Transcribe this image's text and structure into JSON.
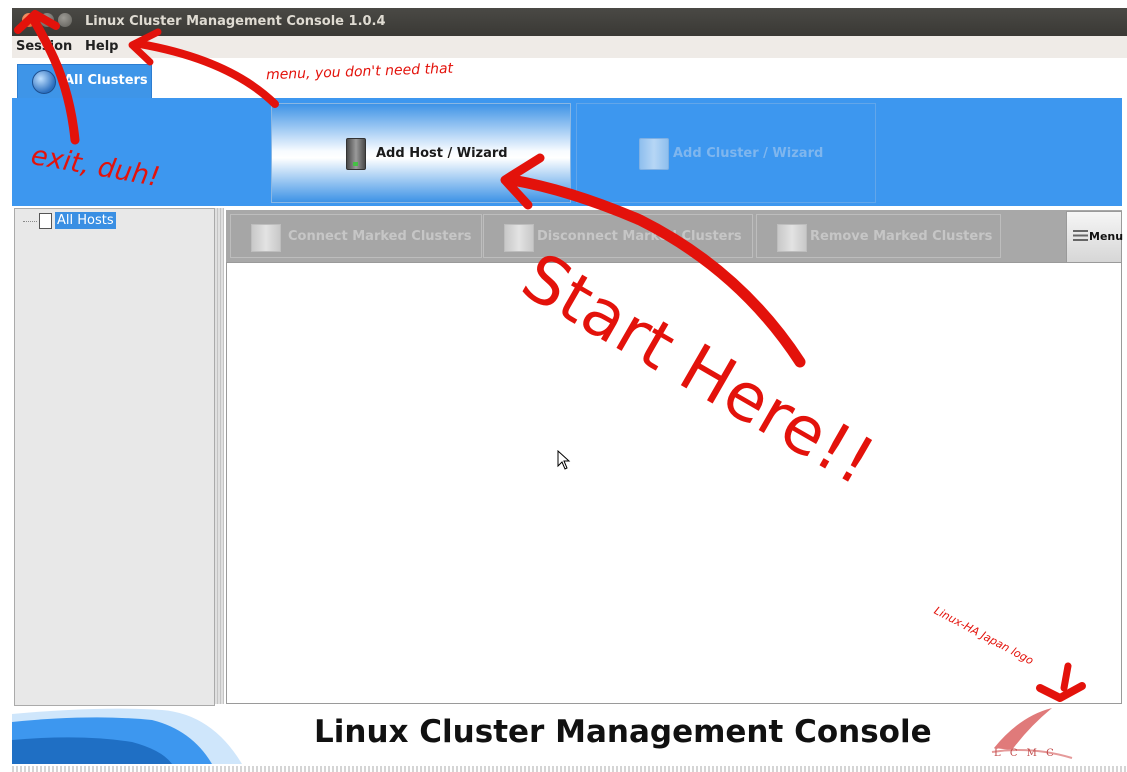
{
  "window": {
    "title": "Linux Cluster Management Console 1.0.4"
  },
  "menubar": {
    "items": [
      "Session",
      "Help"
    ]
  },
  "tabs": [
    {
      "label": "All Clusters"
    }
  ],
  "wizard_buttons": {
    "add_host": "Add Host / Wizard",
    "add_cluster": "Add Cluster / Wizard"
  },
  "tree": {
    "root_label": "All Hosts"
  },
  "cluster_toolbar": {
    "connect": "Connect Marked Clusters",
    "disconnect": "Disconnect Marked Clusters",
    "remove": "Remove Marked Clusters",
    "menu": "Menu"
  },
  "footer": {
    "title": "Linux Cluster Management Console",
    "logo_text": "L C M C"
  },
  "annotations": {
    "menu_note": "menu, you don't need that",
    "exit_note": "exit, duh!",
    "start_note": "Start Here!!",
    "logo_note": "Linux-HA Japan logo"
  },
  "colors": {
    "accent_blue": "#3d97ef",
    "annotation_red": "#e3120b",
    "tab_blue": "#3e95e8"
  },
  "icons": [
    "close-icon",
    "minimize-icon",
    "maximize-icon",
    "globe-icon",
    "server-icon",
    "document-icon",
    "hamburger-icon",
    "cursor-icon"
  ]
}
